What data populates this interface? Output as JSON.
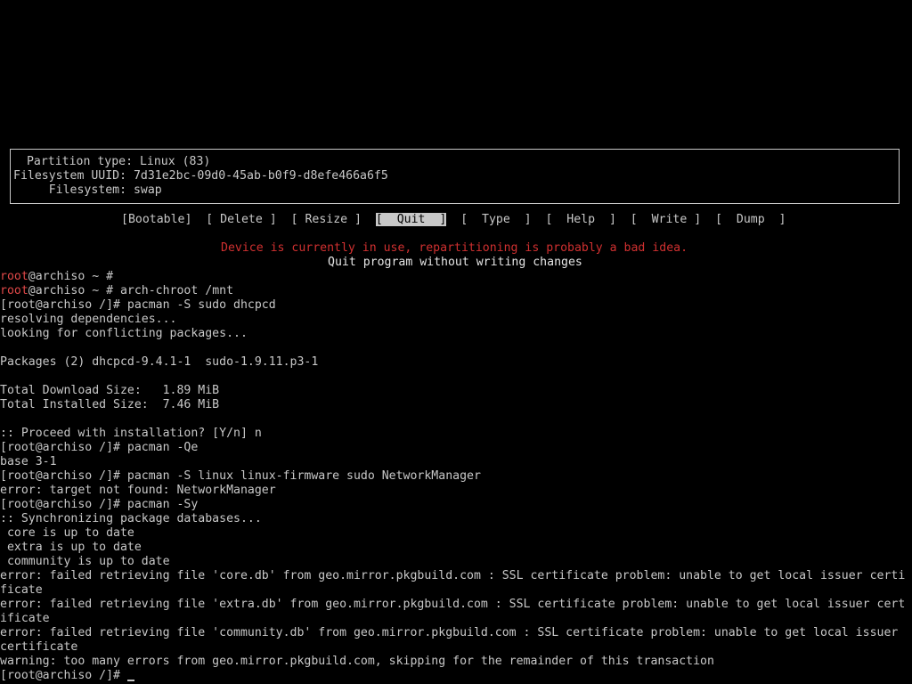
{
  "colors": {
    "background": "#000000",
    "text": "#c8c8c8",
    "warning": "#d03030",
    "root_user": "#e04848",
    "selected_bg": "#c8c8c8"
  },
  "partition_info": {
    "type_line": " Partition type: Linux (83)",
    "uuid_line": "Filesystem UUID: 7d31e2bc-09d0-45ab-b0f9-d8efe466a6f5",
    "fs_line": "     Filesystem: swap"
  },
  "menu": {
    "items": [
      {
        "label": "[Bootable]"
      },
      {
        "label": "[ Delete ]"
      },
      {
        "label": "[ Resize ]"
      },
      {
        "label": "[  Quit  ]"
      },
      {
        "label": "[  Type  ]"
      },
      {
        "label": "[  Help  ]"
      },
      {
        "label": "[  Write ]"
      },
      {
        "label": "[  Dump  ]"
      }
    ],
    "selected_index": 3
  },
  "warning_text": "Device is currently in use, repartitioning is probably a bad idea.",
  "hint_text": "Quit program without writing changes",
  "terminal": {
    "prompt1_user": "root",
    "prompt1_rest": "@archiso ~ #",
    "prompt2_user": "root",
    "prompt2_rest": "@archiso ~ # arch-chroot /mnt",
    "lines": [
      "[root@archiso /]# pacman -S sudo dhcpcd",
      "resolving dependencies...",
      "looking for conflicting packages...",
      "",
      "Packages (2) dhcpcd-9.4.1-1  sudo-1.9.11.p3-1",
      "",
      "Total Download Size:   1.89 MiB",
      "Total Installed Size:  7.46 MiB",
      "",
      ":: Proceed with installation? [Y/n] n",
      "[root@archiso /]# pacman -Qe",
      "base 3-1",
      "[root@archiso /]# pacman -S linux linux-firmware sudo NetworkManager",
      "error: target not found: NetworkManager",
      "[root@archiso /]# pacman -Sy",
      ":: Synchronizing package databases...",
      " core is up to date",
      " extra is up to date",
      " community is up to date",
      "error: failed retrieving file 'core.db' from geo.mirror.pkgbuild.com : SSL certificate problem: unable to get local issuer certi",
      "ficate",
      "error: failed retrieving file 'extra.db' from geo.mirror.pkgbuild.com : SSL certificate problem: unable to get local issuer cert",
      "ificate",
      "error: failed retrieving file 'community.db' from geo.mirror.pkgbuild.com : SSL certificate problem: unable to get local issuer",
      "certificate",
      "warning: too many errors from geo.mirror.pkgbuild.com, skipping for the remainder of this transaction"
    ],
    "final_prompt": "[root@archiso /]# "
  }
}
